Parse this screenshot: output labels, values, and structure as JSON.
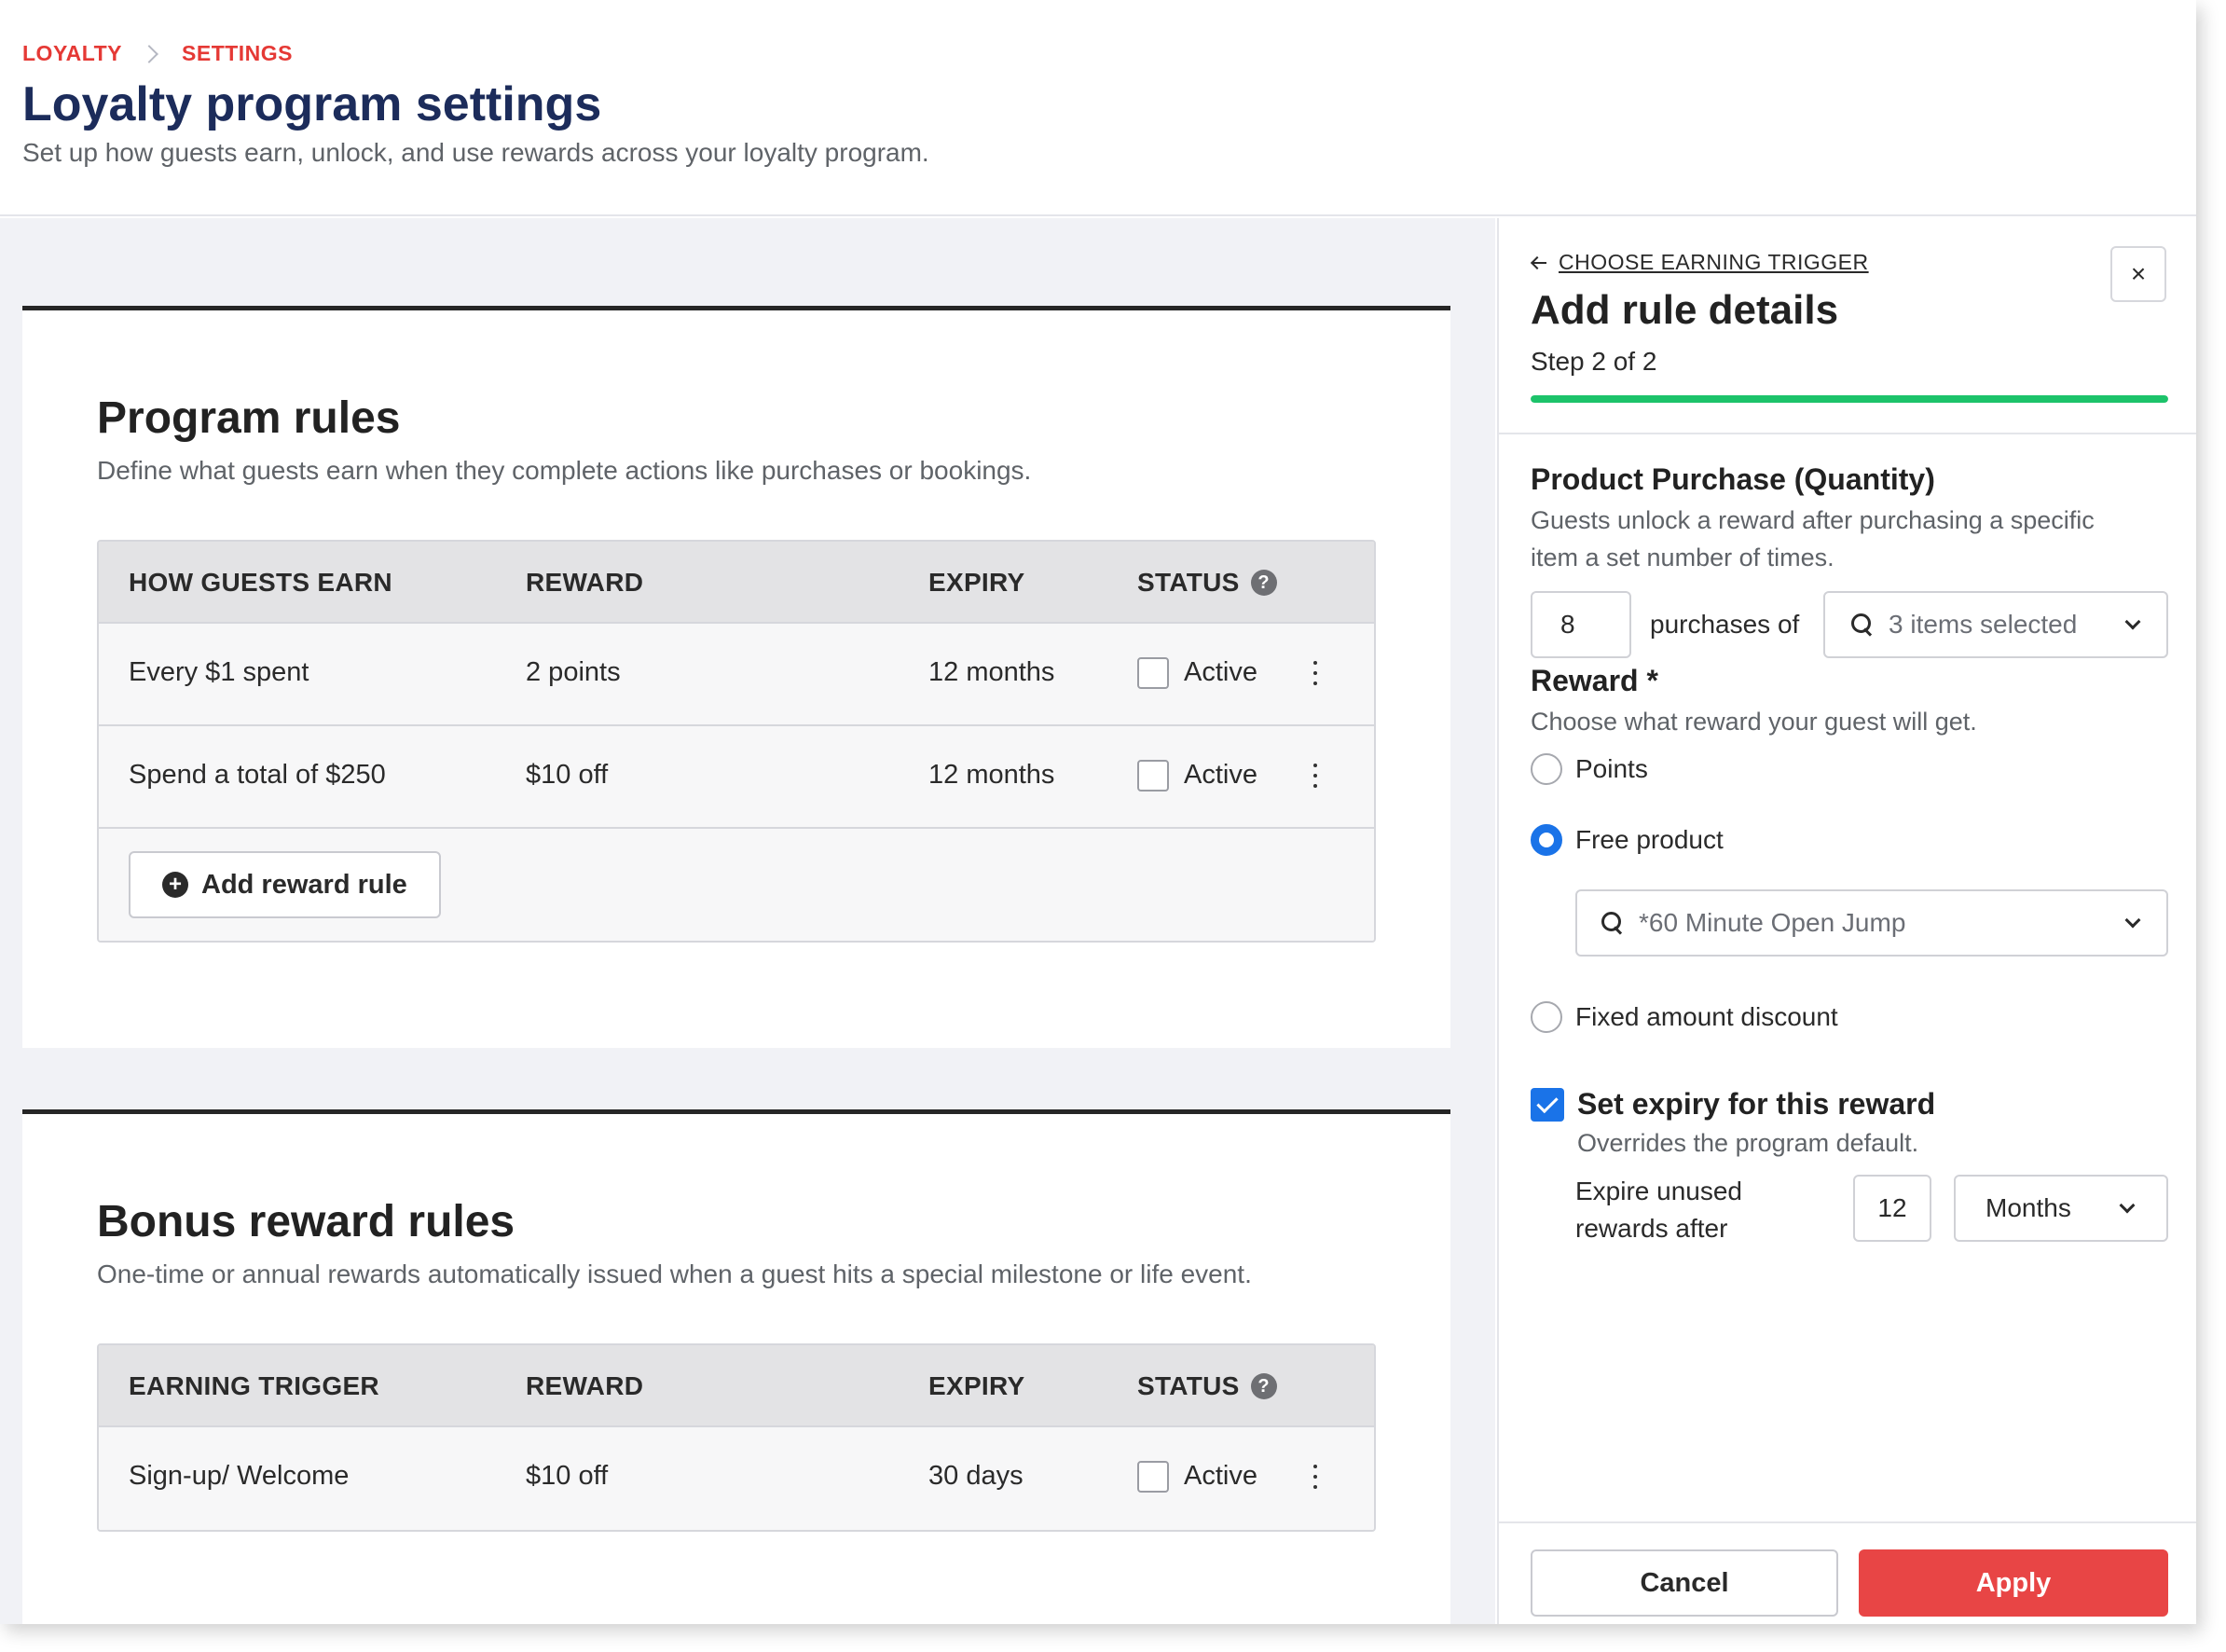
{
  "breadcrumb": {
    "items": [
      "LOYALTY",
      "SETTINGS"
    ]
  },
  "page": {
    "title": "Loyalty program settings",
    "subtitle": "Set up how guests earn, unlock, and use rewards across your loyalty program."
  },
  "program_rules": {
    "title": "Program rules",
    "description": "Define what guests earn when they complete actions like purchases or bookings.",
    "columns": [
      "HOW GUESTS EARN",
      "REWARD",
      "EXPIRY",
      "STATUS"
    ],
    "rows": [
      {
        "trigger": "Every $1 spent",
        "reward": "2 points",
        "expiry": "12 months",
        "status": "Active"
      },
      {
        "trigger": "Spend a total of $250",
        "reward": "$10 off",
        "expiry": "12 months",
        "status": "Active"
      }
    ],
    "add_button": "Add reward rule"
  },
  "bonus_rules": {
    "title": "Bonus reward rules",
    "description": "One-time or annual rewards automatically issued when a guest hits a special milestone or life event.",
    "columns": [
      "EARNING TRIGGER",
      "REWARD",
      "EXPIRY",
      "STATUS"
    ],
    "rows": [
      {
        "trigger": "Sign-up/ Welcome",
        "reward": "$10 off",
        "expiry": "30 days",
        "status": "Active"
      }
    ]
  },
  "panel": {
    "back_label": "CHOOSE EARNING TRIGGER",
    "close_label": "×",
    "title": "Add rule details",
    "step": "Step 2 of 2",
    "progress": 1.0,
    "section": {
      "title": "Product Purchase (Quantity)",
      "description": "Guests unlock a reward after purchasing a specific item a set number of times.",
      "quantity": "8",
      "purchases_label": "purchases of",
      "items_value": "3 items selected"
    },
    "reward": {
      "title": "Reward *",
      "description": "Choose what reward your guest will get.",
      "options": [
        "Points",
        "Free product",
        "Fixed amount discount"
      ],
      "selected": "Free product",
      "product_value": "*60 Minute Open Jump"
    },
    "expiry": {
      "checkbox_label": "Set expiry for this reward",
      "checked": true,
      "note": "Overrides the program default.",
      "label_line1": "Expire unused",
      "label_line2": "rewards after",
      "amount": "12",
      "unit": "Months"
    },
    "cancel_label": "Cancel",
    "apply_label": "Apply"
  },
  "colors": {
    "accent_red": "#e84545",
    "breadcrumb_red": "#e53935",
    "title_navy": "#1c2c5b",
    "progress_green": "#1cc36a",
    "primary_blue": "#1a73e8"
  },
  "icons": [
    "chevron-right-icon",
    "help-icon",
    "kebab-menu-icon",
    "plus-circle-icon",
    "arrow-left-icon",
    "close-icon",
    "search-icon",
    "chevron-down-icon",
    "checkmark-icon"
  ]
}
